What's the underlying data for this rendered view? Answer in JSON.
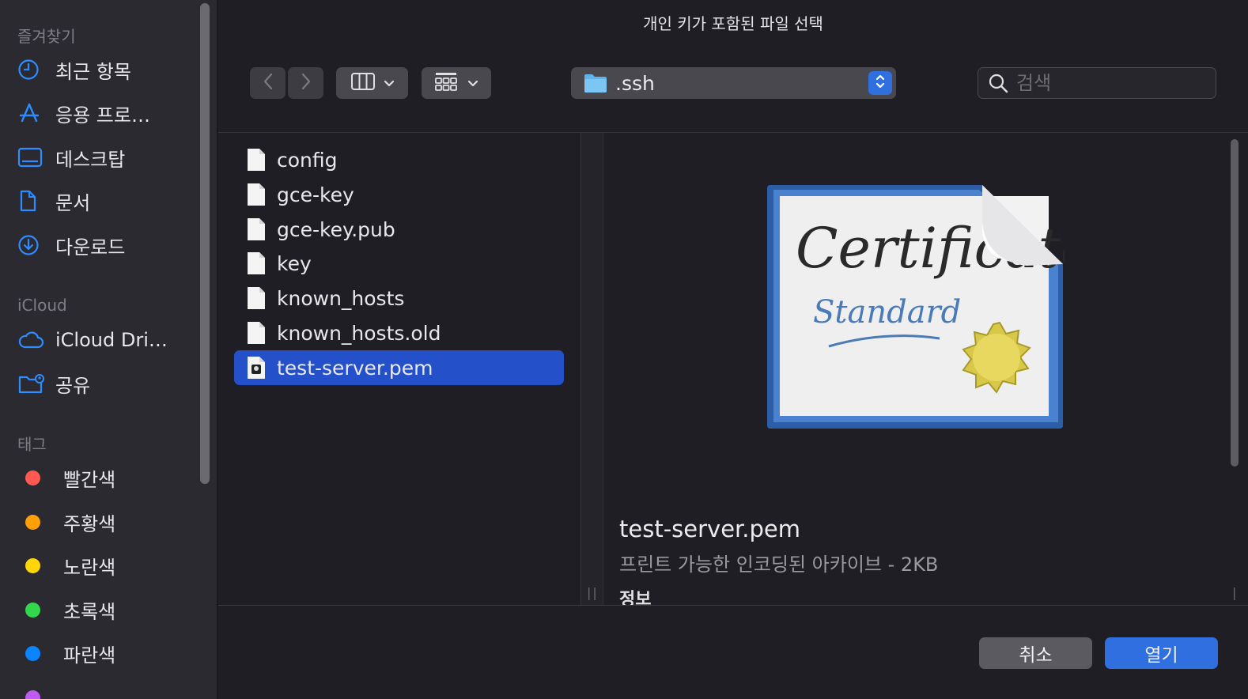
{
  "window": {
    "title": "개인 키가 포함된 파일 선택"
  },
  "sidebar": {
    "favorites_label": "즐겨찾기",
    "favorites": [
      {
        "label": "최근 항목",
        "icon": "clock-icon"
      },
      {
        "label": "응용 프로…",
        "icon": "applications-icon"
      },
      {
        "label": "데스크탑",
        "icon": "desktop-icon"
      },
      {
        "label": "문서",
        "icon": "document-icon"
      },
      {
        "label": "다운로드",
        "icon": "download-icon"
      }
    ],
    "icloud_label": "iCloud",
    "icloud": [
      {
        "label": "iCloud Dri…",
        "icon": "cloud-icon"
      },
      {
        "label": "공유",
        "icon": "shared-folder-icon"
      }
    ],
    "tags_label": "태그",
    "tags": [
      {
        "label": "빨간색",
        "color": "#ff5a52"
      },
      {
        "label": "주황색",
        "color": "#ff9f0a"
      },
      {
        "label": "노란색",
        "color": "#ffd60a"
      },
      {
        "label": "초록색",
        "color": "#32d74b"
      },
      {
        "label": "파란색",
        "color": "#0a84ff"
      }
    ]
  },
  "toolbar": {
    "path": ".ssh",
    "search_placeholder": "검색"
  },
  "files": [
    {
      "name": "config"
    },
    {
      "name": "gce-key"
    },
    {
      "name": "gce-key.pub"
    },
    {
      "name": "key"
    },
    {
      "name": "known_hosts"
    },
    {
      "name": "known_hosts.old"
    },
    {
      "name": "test-server.pem",
      "selected": true
    }
  ],
  "preview": {
    "name": "test-server.pem",
    "kind": "프린트 가능한 인코딩된 아카이브 - 2KB",
    "info_label": "정보"
  },
  "buttons": {
    "cancel": "취소",
    "open": "열기"
  },
  "colors": {
    "accent": "#2f6fe0",
    "selection": "#2451c9"
  }
}
